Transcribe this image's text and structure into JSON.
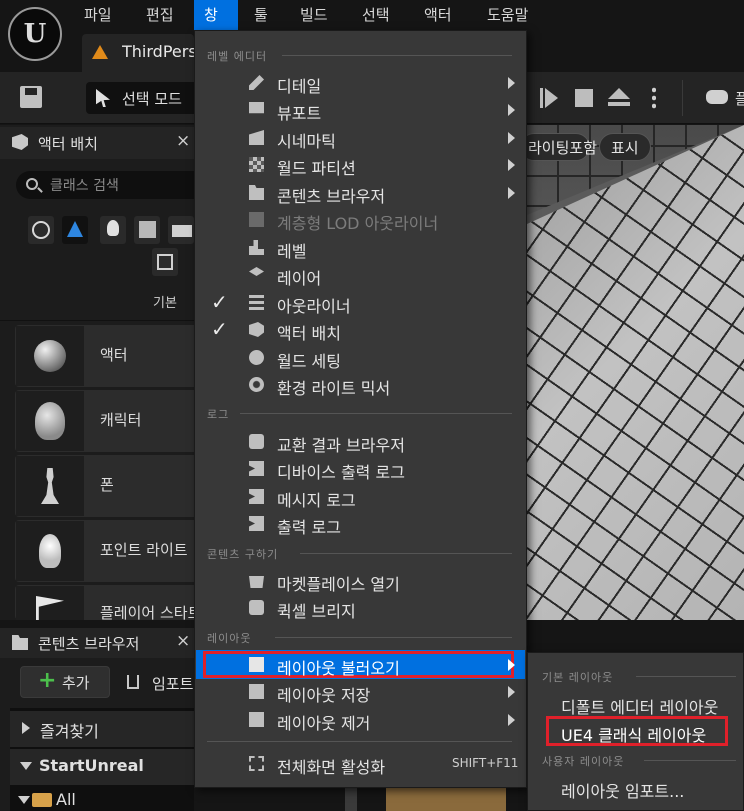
{
  "menubar": {
    "items": [
      "파일",
      "편집",
      "창",
      "툴",
      "빌드",
      "선택",
      "액터",
      "도움말"
    ],
    "active_index": 2
  },
  "tab": {
    "title": "ThirdPerso"
  },
  "toolbar": {
    "select_mode": "선택 모드",
    "right_label": "플"
  },
  "place_actors": {
    "title": "액터 배치",
    "close": "×",
    "search_placeholder": "클래스 검색",
    "category_label": "기본",
    "items": [
      "액터",
      "캐릭터",
      "폰",
      "포인트 라이트",
      "플레이어 스타트"
    ]
  },
  "content_browser": {
    "title": "콘텐츠 브라우저",
    "close": "×",
    "add": "추가",
    "import": "임포트",
    "tree": [
      "즐겨찾기",
      "StartUnreal",
      "All"
    ]
  },
  "viewport": {
    "lighting_pill": "라이팅포함",
    "show_pill": "표시"
  },
  "window_menu": {
    "sections": {
      "level_editor": "레벨 에디터",
      "log": "로그",
      "get_content": "콘텐츠 구하기",
      "layout": "레이아웃"
    },
    "level_editor_items": [
      {
        "label": "디테일",
        "icon": "details-icon",
        "submenu": true
      },
      {
        "label": "뷰포트",
        "icon": "viewport-icon",
        "submenu": true
      },
      {
        "label": "시네마틱",
        "icon": "cinematics-icon",
        "submenu": true
      },
      {
        "label": "월드 파티션",
        "icon": "world-partition-icon",
        "submenu": true
      },
      {
        "label": "콘텐츠 브라우저",
        "icon": "content-browser-icon",
        "submenu": true
      },
      {
        "label": "계층형 LOD 아웃라이너",
        "icon": "hlod-icon",
        "disabled": true
      },
      {
        "label": "레벨",
        "icon": "levels-icon"
      },
      {
        "label": "레이어",
        "icon": "layers-icon"
      },
      {
        "label": "아웃라이너",
        "icon": "outliner-icon",
        "checked": true
      },
      {
        "label": "액터 배치",
        "icon": "place-actors-icon",
        "checked": true
      },
      {
        "label": "월드 세팅",
        "icon": "world-settings-icon"
      },
      {
        "label": "환경 라이트 믹서",
        "icon": "env-light-mixer-icon"
      }
    ],
    "log_items": [
      {
        "label": "교환 결과 브라우저",
        "icon": "interchange-icon"
      },
      {
        "label": "디바이스 출력 로그",
        "icon": "device-log-icon"
      },
      {
        "label": "메시지 로그",
        "icon": "message-log-icon"
      },
      {
        "label": "출력 로그",
        "icon": "output-log-icon"
      }
    ],
    "content_items": [
      {
        "label": "마켓플레이스 열기",
        "icon": "marketplace-icon"
      },
      {
        "label": "퀵셀 브리지",
        "icon": "quixel-bridge-icon"
      }
    ],
    "layout_items": [
      {
        "label": "레이아웃 불러오기",
        "icon": "load-layout-icon",
        "submenu": true,
        "highlighted": true
      },
      {
        "label": "레이아웃 저장",
        "icon": "save-layout-icon",
        "submenu": true
      },
      {
        "label": "레이아웃 제거",
        "icon": "remove-layout-icon",
        "submenu": true
      }
    ],
    "fullscreen": {
      "label": "전체화면 활성화",
      "shortcut": "SHIFT+F11",
      "icon": "fullscreen-icon"
    }
  },
  "load_layout_submenu": {
    "basic_section": "기본 레이아웃",
    "default_layout": "디폴트 에디터 레이아웃",
    "ue4_layout": "UE4 클래식 레이아웃",
    "user_section": "사용자 레이아웃",
    "import_layout": "레이아웃 임포트..."
  },
  "colors": {
    "accent": "#0070e0",
    "highlight_box": "#e0202a",
    "menu_bg": "#383838"
  }
}
